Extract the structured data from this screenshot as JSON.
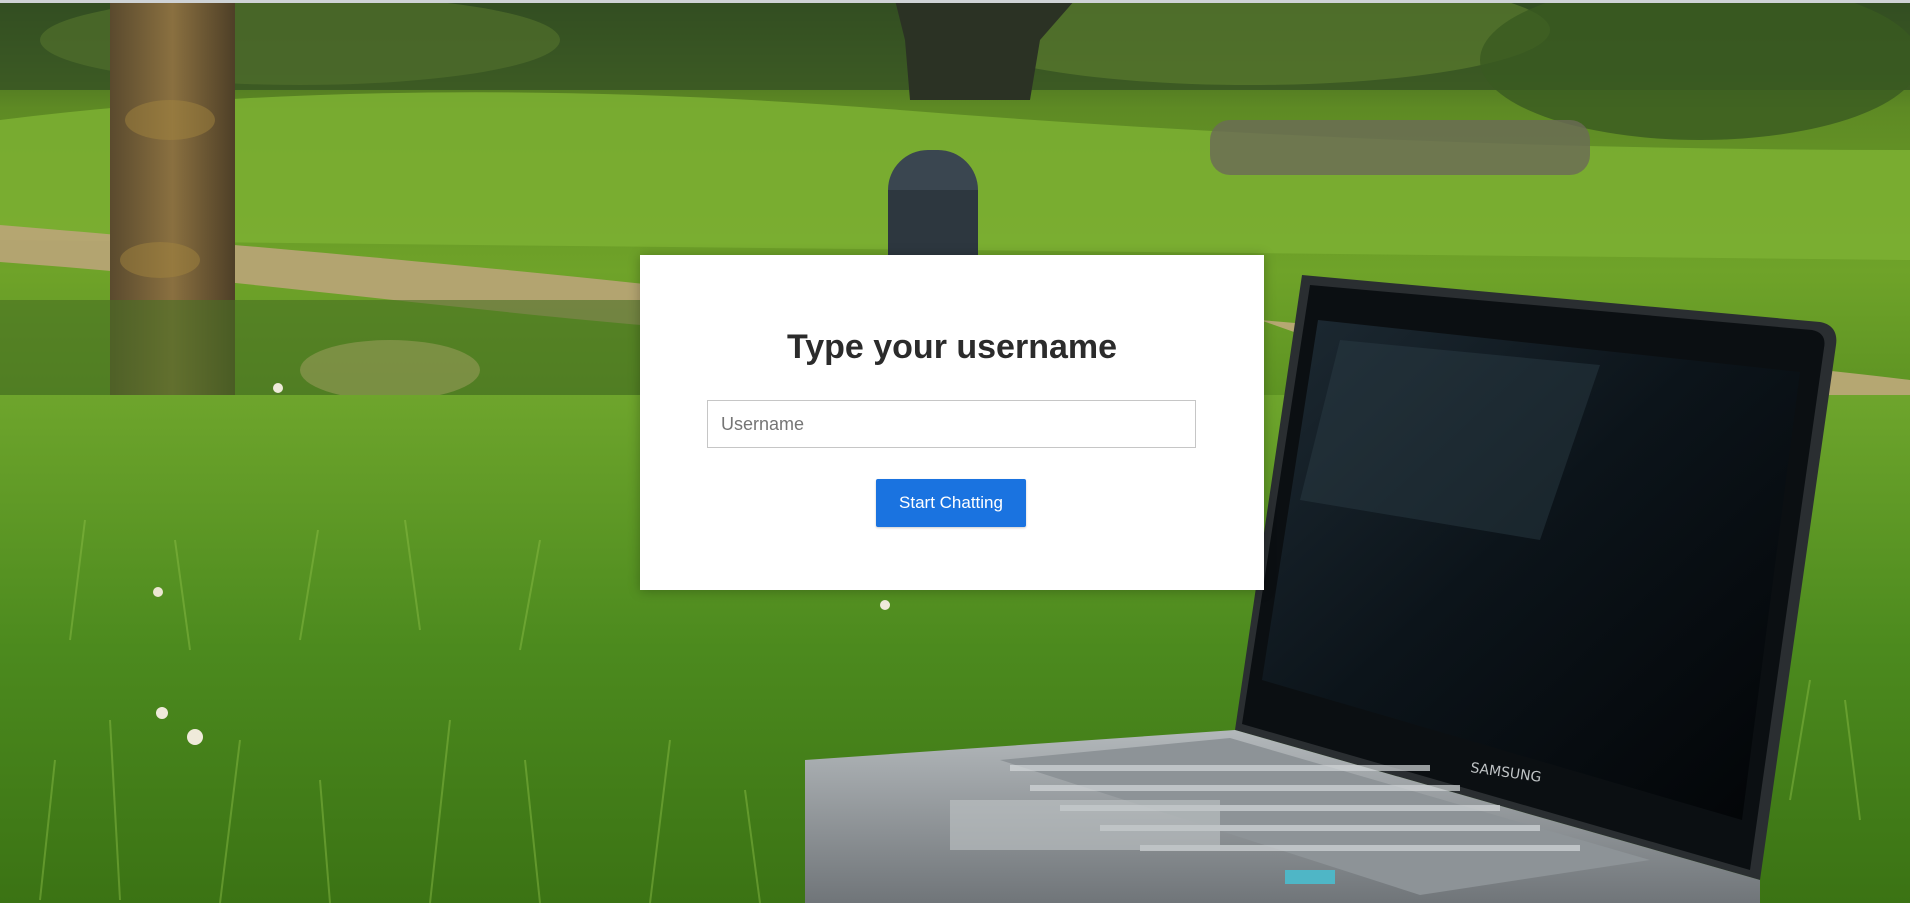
{
  "login": {
    "title": "Type your username",
    "username_placeholder": "Username",
    "username_value": "",
    "start_button_label": "Start Chatting"
  },
  "background": {
    "laptop_brand": "SAMSUNG"
  },
  "colors": {
    "button_bg": "#1a73e0",
    "button_text": "#ffffff",
    "card_bg": "#ffffff",
    "title_text": "#2b2b2b"
  }
}
